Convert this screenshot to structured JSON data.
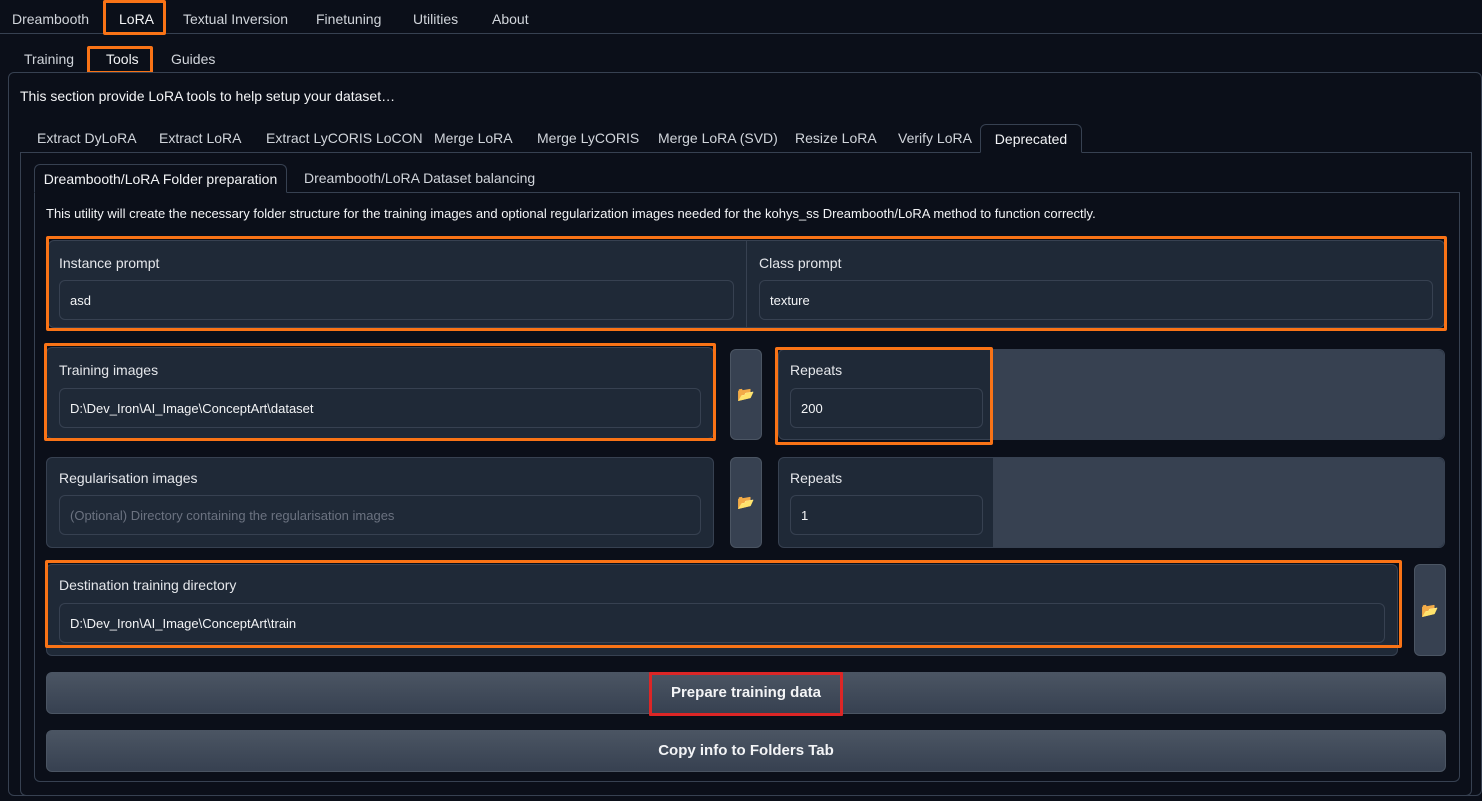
{
  "top_tabs": [
    "Dreambooth",
    "LoRA",
    "Textual Inversion",
    "Finetuning",
    "Utilities",
    "About"
  ],
  "sub_tabs": [
    "Training",
    "Tools",
    "Guides"
  ],
  "intro": "This section provide LoRA tools to help setup your dataset…",
  "tool_tabs": [
    "Extract DyLoRA",
    "Extract LoRA",
    "Extract LyCORIS LoCON",
    "Merge LoRA",
    "Merge LyCORIS",
    "Merge LoRA (SVD)",
    "Resize LoRA",
    "Verify LoRA",
    "Deprecated"
  ],
  "inner_tabs": [
    "Dreambooth/LoRA Folder preparation",
    "Dreambooth/LoRA Dataset balancing"
  ],
  "utility_description": "This utility will create the necessary folder structure for the training images and optional regularization images needed for the kohys_ss Dreambooth/LoRA method to function correctly.",
  "instance_prompt": {
    "label": "Instance prompt",
    "value": "asd"
  },
  "class_prompt": {
    "label": "Class prompt",
    "value": "texture"
  },
  "training_images": {
    "label": "Training images",
    "value": "D:\\Dev_Iron\\AI_Image\\ConceptArt\\dataset"
  },
  "training_repeats": {
    "label": "Repeats",
    "value": "200"
  },
  "regularisation_images": {
    "label": "Regularisation images",
    "placeholder": "(Optional) Directory containing the regularisation images",
    "value": ""
  },
  "regularisation_repeats": {
    "label": "Repeats",
    "value": "1"
  },
  "destination": {
    "label": "Destination training directory",
    "value": "D:\\Dev_Iron\\AI_Image\\ConceptArt\\train"
  },
  "buttons": {
    "prepare": "Prepare training data",
    "copy": "Copy info to Folders Tab"
  },
  "icons": {
    "folder": "folder-icon"
  },
  "colors": {
    "highlight": "#f97316",
    "highlight_red": "#dc2626",
    "background": "#0b0f19",
    "panel": "#1f2937"
  }
}
